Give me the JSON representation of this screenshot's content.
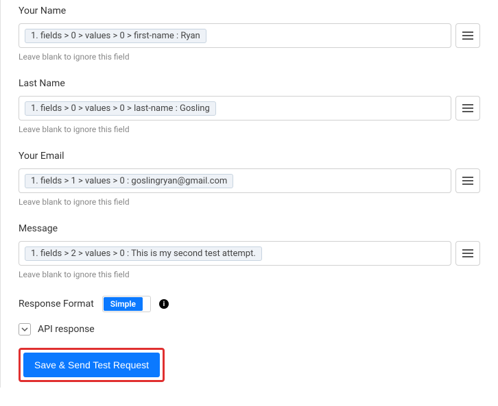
{
  "fields": [
    {
      "label": "Your Name",
      "pill": "1. fields > 0 > values > 0 > first-name : Ryan",
      "helper": "Leave blank to ignore this field"
    },
    {
      "label": "Last Name",
      "pill": "1. fields > 0 > values > 0 > last-name : Gosling",
      "helper": "Leave blank to ignore this field"
    },
    {
      "label": "Your Email",
      "pill": "1. fields > 1 > values > 0 : goslingryan@gmail.com",
      "helper": "Leave blank to ignore this field"
    },
    {
      "label": "Message",
      "pill": "1. fields > 2 > values > 0 : This is my second test attempt.",
      "helper": "Leave blank to ignore this field"
    }
  ],
  "response_format": {
    "label": "Response Format",
    "toggle_active": "Simple"
  },
  "api_response_label": "API response",
  "save_button": "Save & Send Test Request"
}
